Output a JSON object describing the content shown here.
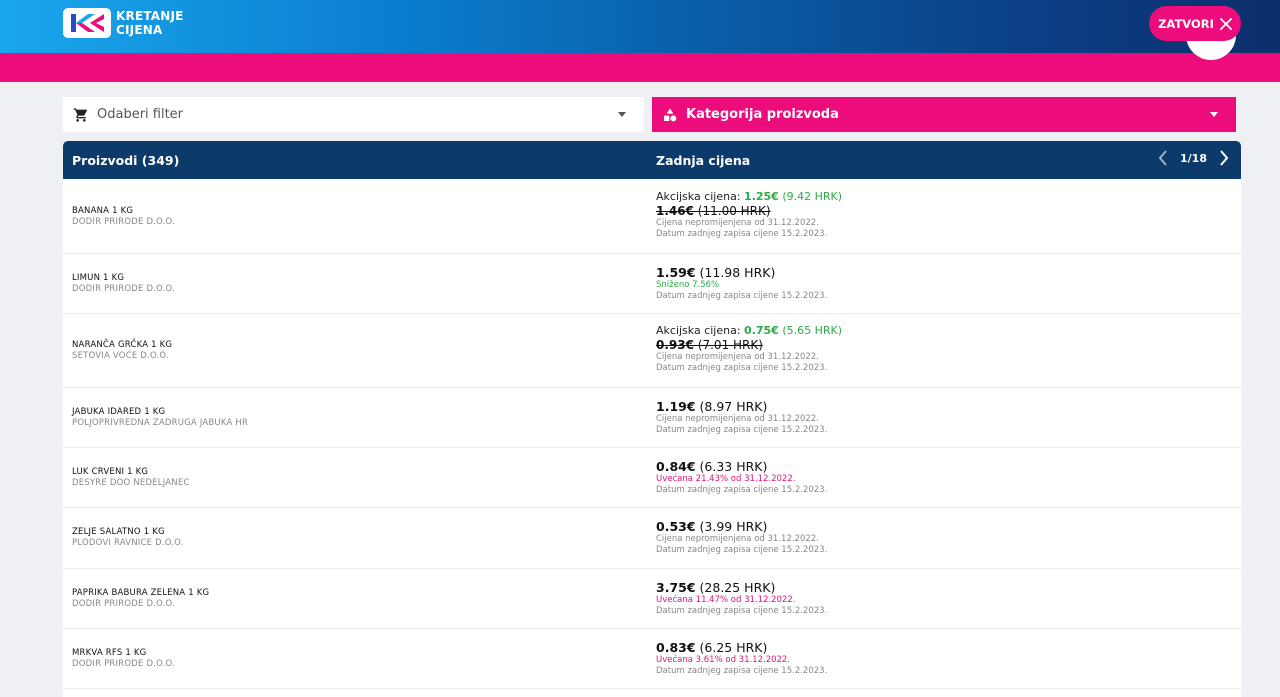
{
  "brand": {
    "line1": "KRETANJE",
    "line2": "CIJENA"
  },
  "header": {
    "close_label": "ZATVORI"
  },
  "filters": {
    "filter_label": "Odaberi filter",
    "category_label": "Kategorija proizvoda"
  },
  "table": {
    "col_products": "Proizvodi (349)",
    "col_price": "Zadnja cijena",
    "page": "1/18",
    "rows": [
      {
        "name": "BANANA 1 KG",
        "vendor": "DODIR PRIRODE D.O.O.",
        "promo_label": "Akcijska cijena:",
        "promo_eur": "1.25€",
        "promo_hrk": "(9.42 HRK)",
        "old_eur": "1.46€",
        "old_hrk": "(11.00 HRK)",
        "note": "Cijena nepromijenjena od 31.12.2022.",
        "date": "Datum zadnjeg zapisa cijene 15.2.2023."
      },
      {
        "name": "LIMUN 1 KG",
        "vendor": "DODIR PRIRODE D.O.O.",
        "eur": "1.59€",
        "hrk": "(11.98 HRK)",
        "change": "Sniženo 7.56%",
        "date": "Datum zadnjeg zapisa cijene 15.2.2023."
      },
      {
        "name": "NARANČA GRČKA 1 KG",
        "vendor": "SETOVIA VOĆE D.O.O.",
        "promo_label": "Akcijska cijena:",
        "promo_eur": "0.75€",
        "promo_hrk": "(5.65 HRK)",
        "old_eur": "0.93€",
        "old_hrk": "(7.01 HRK)",
        "note": "Cijena nepromijenjena od 31.12.2022.",
        "date": "Datum zadnjeg zapisa cijene 15.2.2023."
      },
      {
        "name": "JABUKA IDARED 1 KG",
        "vendor": "POLJOPRIVREDNA ZADRUGA JABUKA HR",
        "eur": "1.19€",
        "hrk": "(8.97 HRK)",
        "note": "Cijena nepromijenjena od 31.12.2022.",
        "date": "Datum zadnjeg zapisa cijene 15.2.2023."
      },
      {
        "name": "LUK CRVENI 1 KG",
        "vendor": "DESYRE DOO NEDELJANEC",
        "eur": "0.84€",
        "hrk": "(6.33 HRK)",
        "change": "Uvećana 21.43% od 31.12.2022.",
        "date": "Datum zadnjeg zapisa cijene 15.2.2023."
      },
      {
        "name": "ZELJE SALATNO 1 KG",
        "vendor": "PLODOVI RAVNICE D.O.O.",
        "eur": "0.53€",
        "hrk": "(3.99 HRK)",
        "note": "Cijena nepromijenjena od 31.12.2022.",
        "date": "Datum zadnjeg zapisa cijene 15.2.2023."
      },
      {
        "name": "PAPRIKA BABURA ZELENA 1 KG",
        "vendor": "DODIR PRIRODE D.O.O.",
        "eur": "3.75€",
        "hrk": "(28.25 HRK)",
        "change": "Uvećana 11.47% od 31.12.2022.",
        "date": "Datum zadnjeg zapisa cijene 15.2.2023."
      },
      {
        "name": "MRKVA RFS 1 KG",
        "vendor": "DODIR PRIRODE D.O.O.",
        "eur": "0.83€",
        "hrk": "(6.25 HRK)",
        "change": "Uvećana 3.61% od 31.12.2022.",
        "date": "Datum zadnjeg zapisa cijene 15.2.2023."
      }
    ]
  },
  "colors": {
    "brand_pink": "#ec0c7b",
    "header_navy": "#0c3a6b",
    "green": "#2eaa48"
  }
}
